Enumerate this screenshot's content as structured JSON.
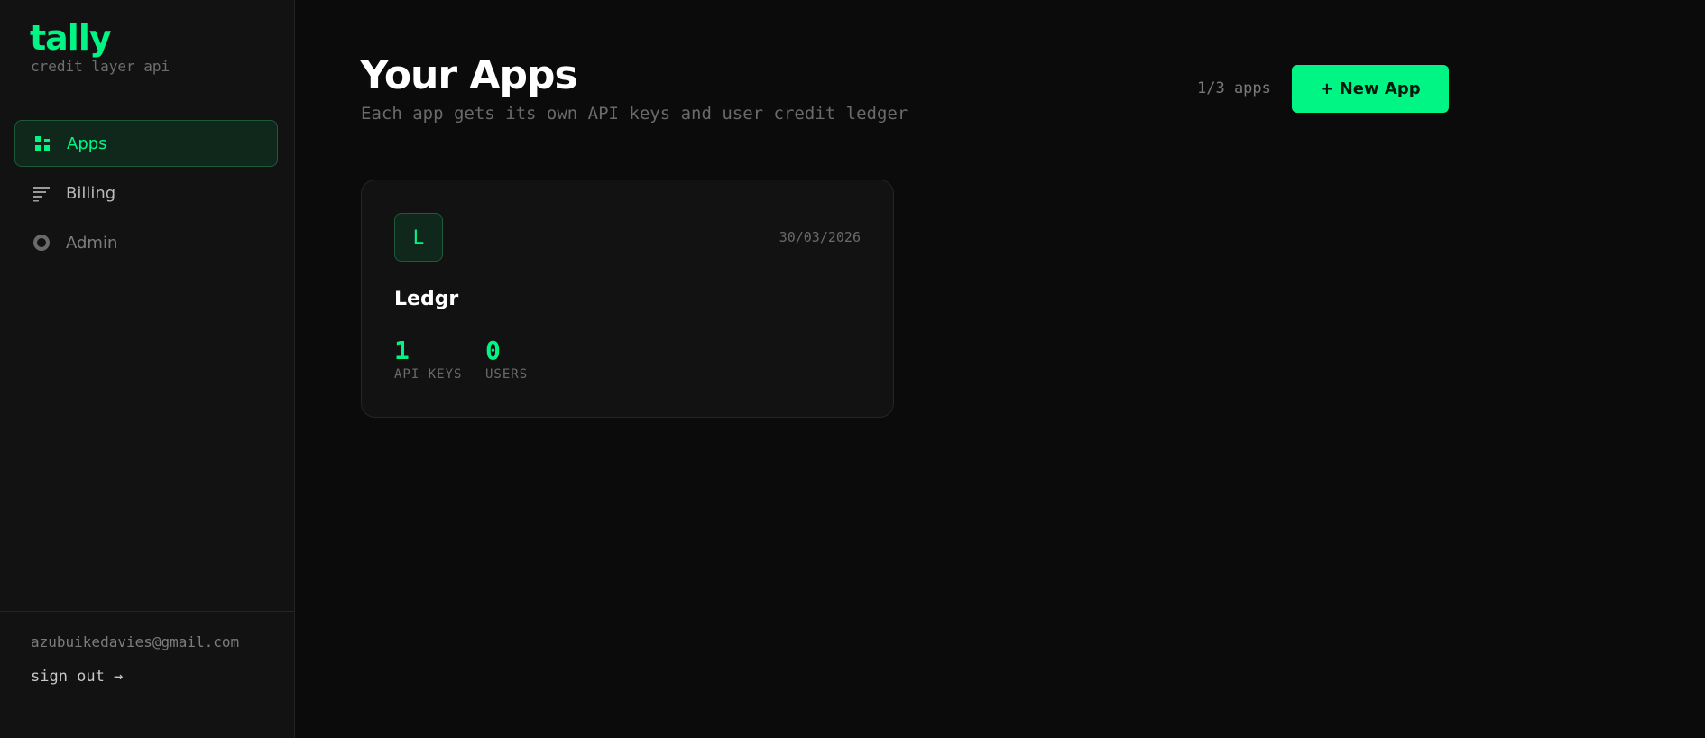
{
  "sidebar": {
    "brand": "tally",
    "tagline": "credit layer api",
    "nav": [
      {
        "label": "Apps",
        "icon": "apps-grid-icon",
        "active": true
      },
      {
        "label": "Billing",
        "icon": "list-lines-icon",
        "active": false
      },
      {
        "label": "Admin",
        "icon": "circle-dot-icon",
        "active": false
      }
    ],
    "user_email": "azubuikedavies@gmail.com",
    "sign_out_label": "sign out →"
  },
  "header": {
    "title": "Your Apps",
    "subtitle": "Each app gets its own API keys and user credit ledger",
    "app_count": "1/3 apps",
    "new_app_label": "+ New App"
  },
  "apps": [
    {
      "initial": "L",
      "name": "Ledgr",
      "created": "30/03/2026",
      "stats": [
        {
          "value": "1",
          "label": "API KEYS"
        },
        {
          "value": "0",
          "label": "USERS"
        }
      ]
    }
  ],
  "colors": {
    "accent": "#00f585",
    "background": "#0b0b0b",
    "sidebar": "#121212"
  }
}
